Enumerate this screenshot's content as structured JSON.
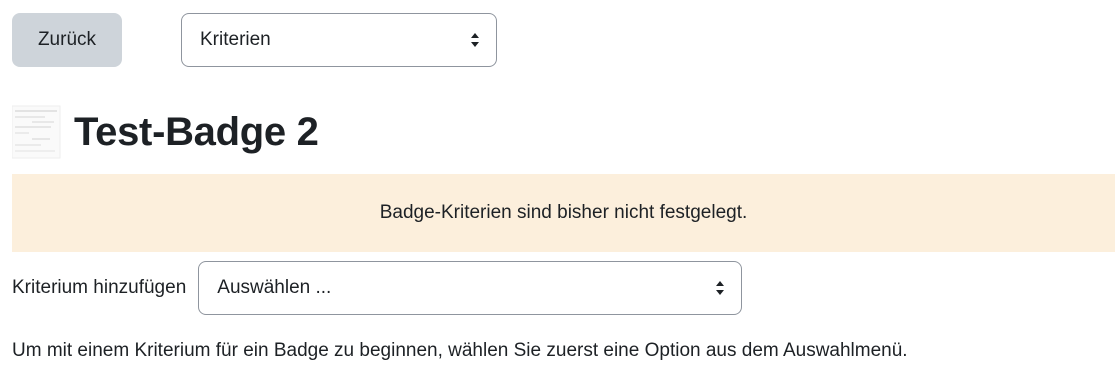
{
  "toolbar": {
    "back_label": "Zurück",
    "section_select_value": "Kriterien"
  },
  "page": {
    "title": "Test-Badge 2"
  },
  "alert": {
    "message": "Badge-Kriterien sind bisher nicht festgelegt."
  },
  "criterion": {
    "label": "Kriterium hinzufügen",
    "select_value": "Auswählen ..."
  },
  "help_text": "Um mit einem Kriterium für ein Badge zu beginnen, wählen Sie zuerst eine Option aus dem Auswahlmenü.",
  "colors": {
    "alert_bg": "#fcefdc",
    "button_bg": "#ced4da",
    "text": "#1d2125"
  },
  "icons": {
    "badge_image": "badge-thumbnail-icon",
    "select_arrows": "sort-arrows-icon"
  }
}
